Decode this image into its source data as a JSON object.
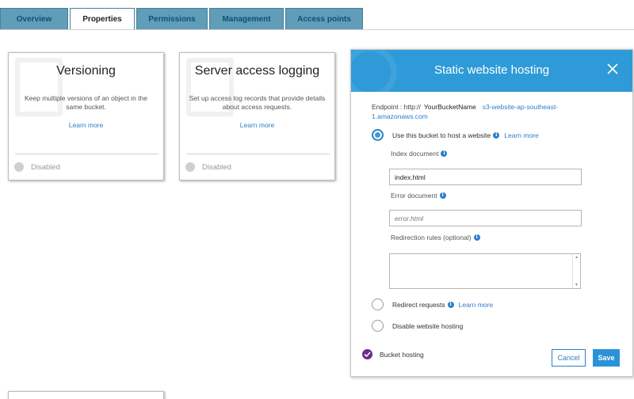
{
  "tabs": [
    {
      "label": "Overview",
      "active": false
    },
    {
      "label": "Properties",
      "active": true
    },
    {
      "label": "Permissions",
      "active": false
    },
    {
      "label": "Management",
      "active": false
    },
    {
      "label": "Access points",
      "active": false
    }
  ],
  "cards": {
    "versioning": {
      "title": "Versioning",
      "description": "Keep multiple versions of an object in the same bucket.",
      "learn_more": "Learn more",
      "status": "Disabled"
    },
    "logging": {
      "title": "Server access logging",
      "description": "Set up access log records that provide details about access requests.",
      "learn_more": "Learn more",
      "status": "Disabled"
    }
  },
  "panel": {
    "title": "Static website hosting",
    "endpoint_label": "Endpoint : http://",
    "bucket_name": "YourBucketName",
    "endpoint_host_1": "s3-website-ap-southeast-",
    "endpoint_host_2": "1.amazonaws.com",
    "option_host": "Use this bucket to host a website",
    "option_host_link": "Learn more",
    "index_label": "Index document",
    "index_value": "index.html",
    "error_label": "Error document",
    "error_placeholder": "error.html",
    "redirection_label": "Redirection rules (optional)",
    "option_redirect": "Redirect requests",
    "option_redirect_link": "Learn more",
    "option_disable": "Disable website hosting",
    "footer_status": "Bucket hosting",
    "cancel_label": "Cancel",
    "save_label": "Save"
  },
  "icons": {
    "close": "close-icon",
    "info": "info-icon",
    "check": "check-icon"
  },
  "colors": {
    "header_blue": "#2e9bd8",
    "tab_blue": "#5f9db8",
    "link_blue": "#2a7fc9",
    "enabled_purple": "#6a2c8e"
  }
}
